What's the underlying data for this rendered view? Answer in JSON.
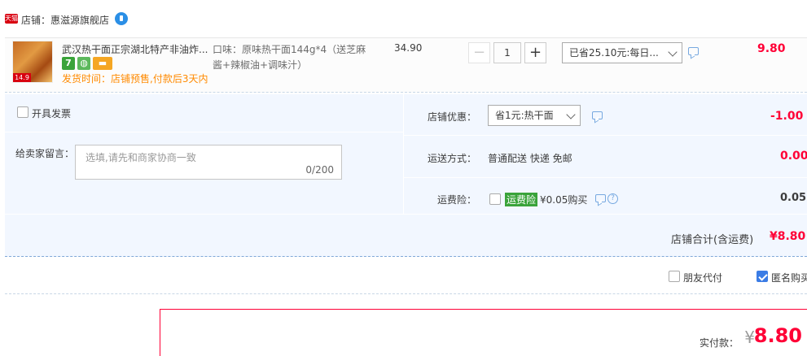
{
  "shop": {
    "badge": "天猫",
    "label": "店铺：惠滋源旗舰店"
  },
  "item": {
    "thumb_tag": "14.9",
    "title": "武汉热干面正宗湖北特产非油炸...",
    "badge_seven": "7",
    "ship_time": "发货时间：店铺预售,付款后3天内",
    "sku": "口味：原味热干面144g*4（送芝麻酱+辣椒油+调味汁）",
    "unit_price": "34.90",
    "quantity": "1",
    "qty_minus": "−",
    "qty_plus": "+",
    "promo": "已省25.10元:每日...",
    "total": "9.80"
  },
  "invoice": {
    "label": "开具发票"
  },
  "memo": {
    "label": "给卖家留言：",
    "placeholder": "选填,请先和商家协商一致",
    "count": "0/200"
  },
  "shop_discount": {
    "label": "店铺优惠：",
    "selected": "省1元:热干面",
    "amount": "-1.00"
  },
  "delivery": {
    "label": "运送方式：",
    "value": "普通配送 快递 免邮",
    "amount": "0.00"
  },
  "insurance": {
    "label": "运费险：",
    "tag": "运费险",
    "price": "¥0.05购买",
    "amount": "0.05"
  },
  "shop_total": {
    "label": "店铺合计(含运费)",
    "amount": "¥8.80"
  },
  "options": {
    "friend_pay": "朋友代付",
    "anonymous": "匿名购买"
  },
  "payment": {
    "label": "实付款：",
    "currency": "¥",
    "amount": "8.80"
  },
  "colors": {
    "price_red": "#ff0036",
    "accent_blue": "#3b7ce5",
    "info_bg": "#f2f7ff"
  }
}
